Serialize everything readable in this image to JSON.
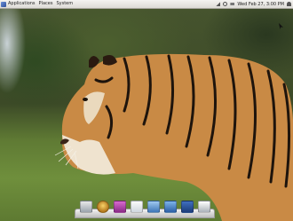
{
  "top_panel": {
    "menu": {
      "applications": "Applications",
      "places": "Places",
      "system": "System"
    },
    "clock": "Wed Feb 27, 3:00 PM",
    "tray_icons": [
      "network-icon",
      "volume-icon",
      "mail-icon",
      "power-icon"
    ]
  },
  "desktop": {
    "wallpaper": "tiger-wallpaper"
  },
  "dock": {
    "icons": [
      "finder-icon",
      "camera-icon",
      "media-icon",
      "text-editor-icon",
      "folder-icon",
      "documents-icon",
      "monitor-icon",
      "trash-icon"
    ]
  }
}
